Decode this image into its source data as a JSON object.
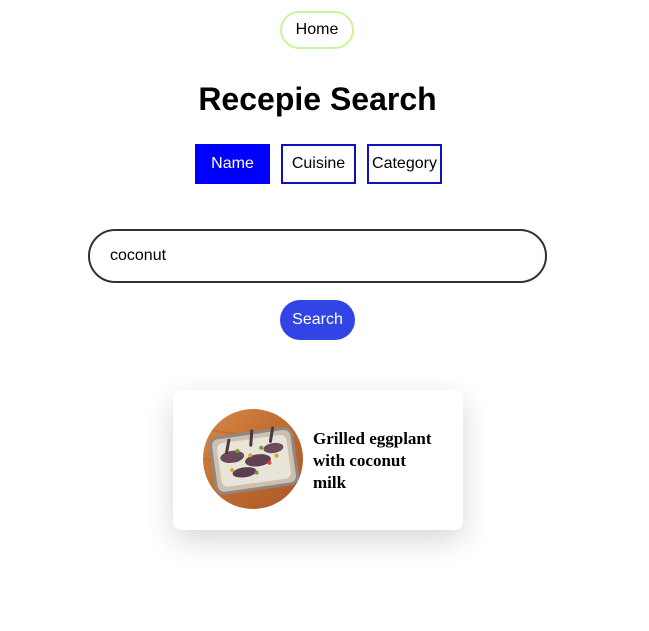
{
  "nav": {
    "home_label": "Home"
  },
  "page": {
    "title": "Recepie Search"
  },
  "filters": {
    "name_label": "Name",
    "cuisine_label": "Cuisine",
    "category_label": "Category",
    "active": "Name"
  },
  "search": {
    "value": "coconut",
    "button_label": "Search"
  },
  "results": [
    {
      "title": "Grilled eggplant with coconut milk",
      "image_icon": "food-photo-icon"
    }
  ],
  "colors": {
    "home_border": "#c8f59a",
    "filter_active_bg": "#0000ff",
    "filter_border": "#1010c0",
    "search_button_bg": "#3344e6"
  }
}
